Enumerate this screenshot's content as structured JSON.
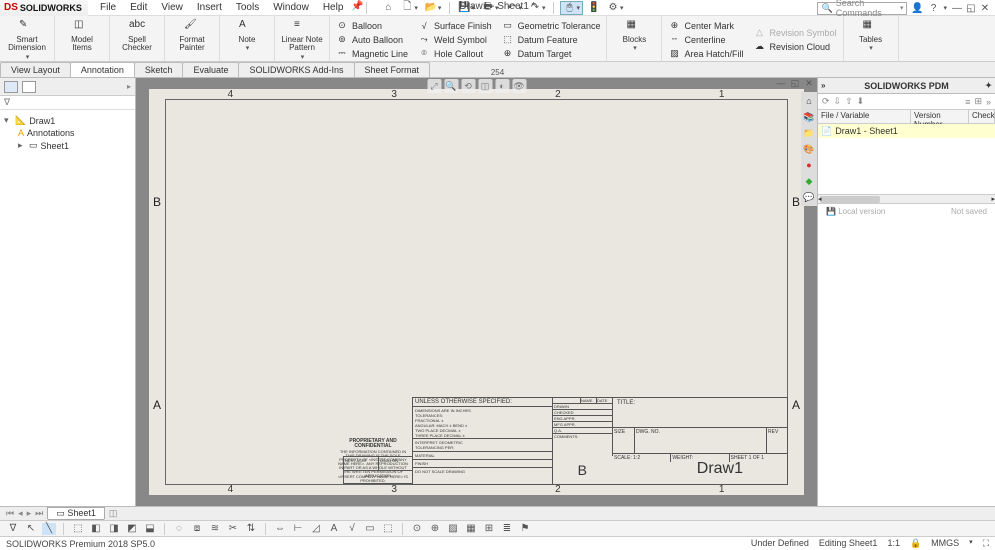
{
  "app": {
    "brand_prefix": "DS",
    "brand": "SOLIDWORKS",
    "doc_title": "Draw1 - Sheet1 *"
  },
  "menus": [
    "File",
    "Edit",
    "View",
    "Insert",
    "Tools",
    "Window",
    "Help"
  ],
  "search": {
    "placeholder": "Search Commands"
  },
  "ribbon": {
    "smart_dim": "Smart\nDimension",
    "model_items": "Model\nItems",
    "spell": "Spell\nChecker",
    "format": "Format\nPainter",
    "note": "Note",
    "linear_note": "Linear Note\nPattern",
    "col1": {
      "a": "Balloon",
      "b": "Auto Balloon",
      "c": "Magnetic Line"
    },
    "col2": {
      "a": "Surface Finish",
      "b": "Weld Symbol",
      "c": "Hole Callout"
    },
    "col3": {
      "a": "Geometric Tolerance",
      "b": "Datum Feature",
      "c": "Datum Target"
    },
    "blocks": "Blocks",
    "col4": {
      "a": "Center Mark",
      "b": "Centerline",
      "c": "Area Hatch/Fill"
    },
    "col5": {
      "a": "Revision Symbol",
      "b": "Revision Cloud"
    },
    "tables": "Tables"
  },
  "tabs": [
    "View Layout",
    "Annotation",
    "Sketch",
    "Evaluate",
    "SOLIDWORKS Add-Ins",
    "Sheet Format"
  ],
  "tabs_active_index": 1,
  "ruler_center": "254",
  "tree": {
    "root": "Draw1",
    "ann": "Annotations",
    "sheet": "Sheet1"
  },
  "drawing": {
    "cols_top": [
      "4",
      "3",
      "2",
      "1"
    ],
    "rows": [
      "B",
      "A"
    ],
    "titleblock": {
      "draw_name": "Draw1",
      "size": "B",
      "title_label": "TITLE:",
      "size_label": "SIZE",
      "dwg_label": "DWG.  NO.",
      "rev_label": "REV",
      "scale": "SCALE: 1:2",
      "weight": "WEIGHT:",
      "sheet": "SHEET 1 OF 1",
      "unless": "UNLESS OTHERWISE SPECIFIED:",
      "dims": "DIMENSIONS ARE IN INCHES\nTOLERANCES:\nFRACTIONAL ±\nANGULAR: MACH ±   BEND ±\nTWO PLACE DECIMAL    ±\nTHREE PLACE DECIMAL  ±",
      "interp": "INTERPRET GEOMETRIC\nTOLERANCING PER:",
      "material": "MATERIAL",
      "finish": "FINISH",
      "dns": "DO NOT SCALE DRAWING",
      "name": "NAME",
      "date": "DATE",
      "drawn": "DRAWN",
      "checked": "CHECKED",
      "eng": "ENG APPR.",
      "mfg": "MFG APPR.",
      "qa": "Q.A.",
      "comments": "COMMENTS:",
      "app": "APPLICATION",
      "next": "NEXT ASSY",
      "used": "USED ON",
      "conf": "PROPRIETARY AND CONFIDENTIAL",
      "conf_body": "THE INFORMATION CONTAINED IN THIS DRAWING IS THE SOLE PROPERTY OF <INSERT COMPANY NAME HERE>.  ANY REPRODUCTION IN PART OR AS A WHOLE WITHOUT THE WRITTEN PERMISSION OF <INSERT COMPANY NAME HERE> IS PROHIBITED."
    }
  },
  "pdm": {
    "title": "SOLIDWORKS PDM",
    "col_file": "File / Variable",
    "col_ver": "Version Number",
    "col_check": "Check",
    "row0": "Draw1 - Sheet1",
    "local": "Local version",
    "notsaved": "Not saved"
  },
  "sheet_tab": "Sheet1",
  "status": {
    "left": "SOLIDWORKS Premium 2018 SP5.0",
    "under": "Under Defined",
    "editing": "Editing Sheet1",
    "scale": "1:1",
    "units": "MMGS"
  }
}
